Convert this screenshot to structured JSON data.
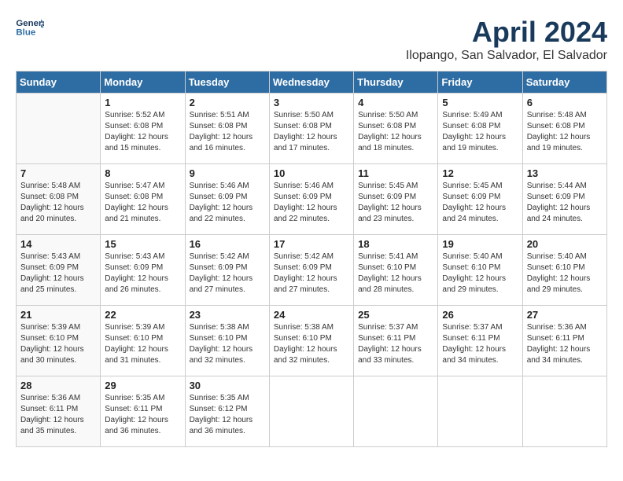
{
  "header": {
    "logo_line1": "General",
    "logo_line2": "Blue",
    "month": "April 2024",
    "location": "Ilopango, San Salvador, El Salvador"
  },
  "weekdays": [
    "Sunday",
    "Monday",
    "Tuesday",
    "Wednesday",
    "Thursday",
    "Friday",
    "Saturday"
  ],
  "weeks": [
    [
      {
        "day": "",
        "info": ""
      },
      {
        "day": "1",
        "info": "Sunrise: 5:52 AM\nSunset: 6:08 PM\nDaylight: 12 hours\nand 15 minutes."
      },
      {
        "day": "2",
        "info": "Sunrise: 5:51 AM\nSunset: 6:08 PM\nDaylight: 12 hours\nand 16 minutes."
      },
      {
        "day": "3",
        "info": "Sunrise: 5:50 AM\nSunset: 6:08 PM\nDaylight: 12 hours\nand 17 minutes."
      },
      {
        "day": "4",
        "info": "Sunrise: 5:50 AM\nSunset: 6:08 PM\nDaylight: 12 hours\nand 18 minutes."
      },
      {
        "day": "5",
        "info": "Sunrise: 5:49 AM\nSunset: 6:08 PM\nDaylight: 12 hours\nand 19 minutes."
      },
      {
        "day": "6",
        "info": "Sunrise: 5:48 AM\nSunset: 6:08 PM\nDaylight: 12 hours\nand 19 minutes."
      }
    ],
    [
      {
        "day": "7",
        "info": "Sunrise: 5:48 AM\nSunset: 6:08 PM\nDaylight: 12 hours\nand 20 minutes."
      },
      {
        "day": "8",
        "info": "Sunrise: 5:47 AM\nSunset: 6:08 PM\nDaylight: 12 hours\nand 21 minutes."
      },
      {
        "day": "9",
        "info": "Sunrise: 5:46 AM\nSunset: 6:09 PM\nDaylight: 12 hours\nand 22 minutes."
      },
      {
        "day": "10",
        "info": "Sunrise: 5:46 AM\nSunset: 6:09 PM\nDaylight: 12 hours\nand 22 minutes."
      },
      {
        "day": "11",
        "info": "Sunrise: 5:45 AM\nSunset: 6:09 PM\nDaylight: 12 hours\nand 23 minutes."
      },
      {
        "day": "12",
        "info": "Sunrise: 5:45 AM\nSunset: 6:09 PM\nDaylight: 12 hours\nand 24 minutes."
      },
      {
        "day": "13",
        "info": "Sunrise: 5:44 AM\nSunset: 6:09 PM\nDaylight: 12 hours\nand 24 minutes."
      }
    ],
    [
      {
        "day": "14",
        "info": "Sunrise: 5:43 AM\nSunset: 6:09 PM\nDaylight: 12 hours\nand 25 minutes."
      },
      {
        "day": "15",
        "info": "Sunrise: 5:43 AM\nSunset: 6:09 PM\nDaylight: 12 hours\nand 26 minutes."
      },
      {
        "day": "16",
        "info": "Sunrise: 5:42 AM\nSunset: 6:09 PM\nDaylight: 12 hours\nand 27 minutes."
      },
      {
        "day": "17",
        "info": "Sunrise: 5:42 AM\nSunset: 6:09 PM\nDaylight: 12 hours\nand 27 minutes."
      },
      {
        "day": "18",
        "info": "Sunrise: 5:41 AM\nSunset: 6:10 PM\nDaylight: 12 hours\nand 28 minutes."
      },
      {
        "day": "19",
        "info": "Sunrise: 5:40 AM\nSunset: 6:10 PM\nDaylight: 12 hours\nand 29 minutes."
      },
      {
        "day": "20",
        "info": "Sunrise: 5:40 AM\nSunset: 6:10 PM\nDaylight: 12 hours\nand 29 minutes."
      }
    ],
    [
      {
        "day": "21",
        "info": "Sunrise: 5:39 AM\nSunset: 6:10 PM\nDaylight: 12 hours\nand 30 minutes."
      },
      {
        "day": "22",
        "info": "Sunrise: 5:39 AM\nSunset: 6:10 PM\nDaylight: 12 hours\nand 31 minutes."
      },
      {
        "day": "23",
        "info": "Sunrise: 5:38 AM\nSunset: 6:10 PM\nDaylight: 12 hours\nand 32 minutes."
      },
      {
        "day": "24",
        "info": "Sunrise: 5:38 AM\nSunset: 6:10 PM\nDaylight: 12 hours\nand 32 minutes."
      },
      {
        "day": "25",
        "info": "Sunrise: 5:37 AM\nSunset: 6:11 PM\nDaylight: 12 hours\nand 33 minutes."
      },
      {
        "day": "26",
        "info": "Sunrise: 5:37 AM\nSunset: 6:11 PM\nDaylight: 12 hours\nand 34 minutes."
      },
      {
        "day": "27",
        "info": "Sunrise: 5:36 AM\nSunset: 6:11 PM\nDaylight: 12 hours\nand 34 minutes."
      }
    ],
    [
      {
        "day": "28",
        "info": "Sunrise: 5:36 AM\nSunset: 6:11 PM\nDaylight: 12 hours\nand 35 minutes."
      },
      {
        "day": "29",
        "info": "Sunrise: 5:35 AM\nSunset: 6:11 PM\nDaylight: 12 hours\nand 36 minutes."
      },
      {
        "day": "30",
        "info": "Sunrise: 5:35 AM\nSunset: 6:12 PM\nDaylight: 12 hours\nand 36 minutes."
      },
      {
        "day": "",
        "info": ""
      },
      {
        "day": "",
        "info": ""
      },
      {
        "day": "",
        "info": ""
      },
      {
        "day": "",
        "info": ""
      }
    ]
  ]
}
